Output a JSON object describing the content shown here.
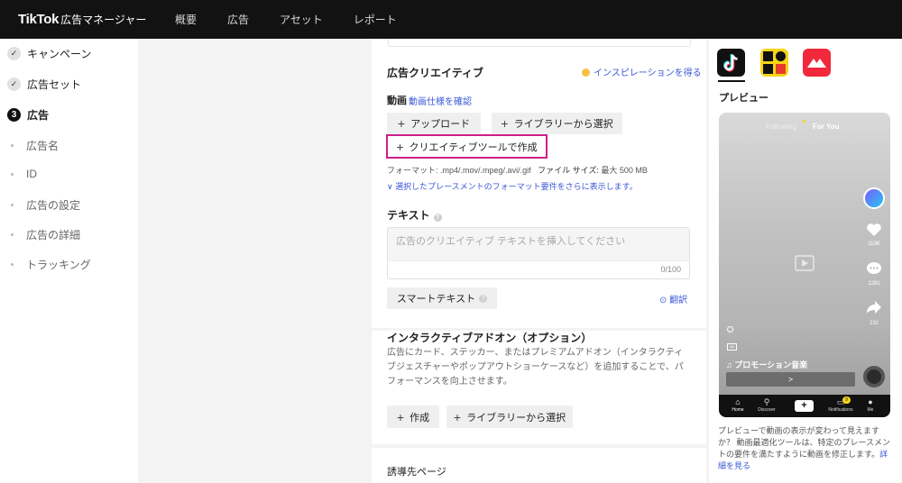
{
  "header": {
    "brand": "TikTok",
    "brand_sub": "広告マネージャー",
    "nav": [
      "概要",
      "広告",
      "アセット",
      "レポート"
    ]
  },
  "sidebar": {
    "campaign": "キャンペーン",
    "adset": "広告セット",
    "ad_number": "3",
    "ad": "広告",
    "sub_items": [
      "広告名",
      "ID",
      "広告の設定",
      "広告の詳細",
      "トラッキング"
    ]
  },
  "creative": {
    "title": "広告クリエイティブ",
    "inspiration_link": "インスピレーションを得る",
    "video_label": "動画",
    "video_spec_link": "動画仕様を確認",
    "upload_button": "アップロード",
    "library_button": "ライブラリーから選択",
    "create_tool_button": "クリエイティブツールで作成",
    "format_label": "フォーマット:",
    "format_value": ".mp4/.mov/.mpeg/.avi/.gif",
    "filesize_label": "ファイル サイズ:",
    "filesize_value": "最大 500 MB",
    "placement_link": "選択したプレースメントのフォーマット要件をさらに表示します。"
  },
  "text_section": {
    "title": "テキスト",
    "placeholder": "広告のクリエイティブ テキストを挿入してください",
    "counter": "0/100",
    "smart_text_button": "スマートテキスト",
    "translate_link": "翻訳"
  },
  "addon": {
    "title": "インタラクティブアドオン（オプション）",
    "description": "広告にカード、ステッカー、またはプレミアムアドオン（インタラクティブジェスチャーやポップアウトショーケースなど）を追加することで、パフォーマンスを向上させます。",
    "create_button": "作成",
    "library_button": "ライブラリーから選択"
  },
  "destination": {
    "title": "誘導先ページ"
  },
  "preview": {
    "label": "プレビュー",
    "tab_following": "Following",
    "tab_for_you": "For You",
    "likes": "113K",
    "comments": "1281",
    "shares": "232",
    "music": "プロモーション音楽",
    "cta_arrow": ">",
    "nav": [
      "Home",
      "Discover",
      "+",
      "Notifications",
      "Me"
    ],
    "notif_badge": "9",
    "note_text": "プレビューで動画の表示が変わって見えますか？ 動画最適化ツールは、特定のプレースメントの要件を満たすように動画を修正します。",
    "note_link": "詳細を見る"
  },
  "colors": {
    "highlight": "#d11e8a",
    "link": "#3a57d6",
    "topbar": "#121212"
  }
}
